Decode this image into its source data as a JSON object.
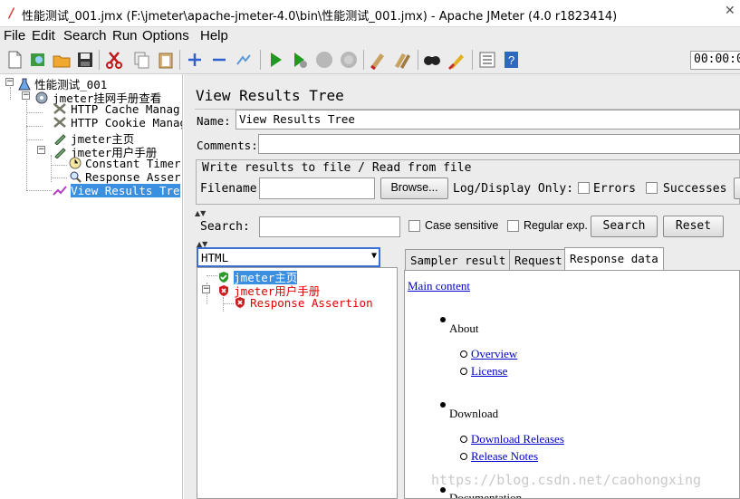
{
  "window": {
    "title": "性能测试_001.jmx (F:\\jmeter\\apache-jmeter-4.0\\bin\\性能测试_001.jmx) - Apache JMeter (4.0 r1823414)"
  },
  "menu": [
    "File",
    "Edit",
    "Search",
    "Run",
    "Options",
    "Help"
  ],
  "toolbar": {
    "timer": "00:00:0",
    "icons": [
      "new-icon",
      "templates-icon",
      "open-icon",
      "save-icon",
      "cut-icon",
      "copy-icon",
      "paste-icon",
      "expand-icon",
      "collapse-icon",
      "toggle-icon",
      "start-icon",
      "start-no-pause-icon",
      "stop-icon",
      "shutdown-icon",
      "clear-icon",
      "clear-all-icon",
      "search-icon",
      "reset-search-icon",
      "function-helper-icon",
      "help-icon"
    ]
  },
  "tree": {
    "root": "性能测试_001",
    "thread_group": "jmeter挂网手册查看",
    "cache_manager": "HTTP Cache Manag",
    "cookie_manager": "HTTP Cookie Manag",
    "sampler1": "jmeter主页",
    "sampler2": "jmeter用户手册",
    "timer": "Constant Timer",
    "assertion": "Response Asser",
    "listener": "View Results Tre"
  },
  "panel": {
    "title": "View Results Tree",
    "name_label": "Name:",
    "name_value": "View Results Tree",
    "comments_label": "Comments:",
    "comments_value": "",
    "write_section": "Write results to file / Read from file",
    "filename_label": "Filename",
    "filename_value": "",
    "browse_button": "Browse...",
    "logdisplay_label": "Log/Display Only:",
    "errors_label": "Errors",
    "successes_label": "Successes",
    "search_label": "Search:",
    "search_value": "",
    "case_sensitive": "Case sensitive",
    "regular_exp": "Regular exp.",
    "search_button": "Search",
    "reset_button": "Reset"
  },
  "results": {
    "renderer": "HTML",
    "items": [
      {
        "label": "jmeter主页",
        "status": "success"
      },
      {
        "label": "jmeter用户手册",
        "status": "failure"
      },
      {
        "label": "Response Assertion",
        "status": "failure"
      }
    ]
  },
  "tabs": [
    "Sampler result",
    "Request",
    "Response data"
  ],
  "response": {
    "main_content": "Main content",
    "about": "About",
    "overview": "Overview",
    "license": "License",
    "download": "Download",
    "download_releases": "Download Releases",
    "release_notes": "Release Notes",
    "documentation": "Documentation"
  },
  "watermark": "https://blog.csdn.net/caohongxing"
}
